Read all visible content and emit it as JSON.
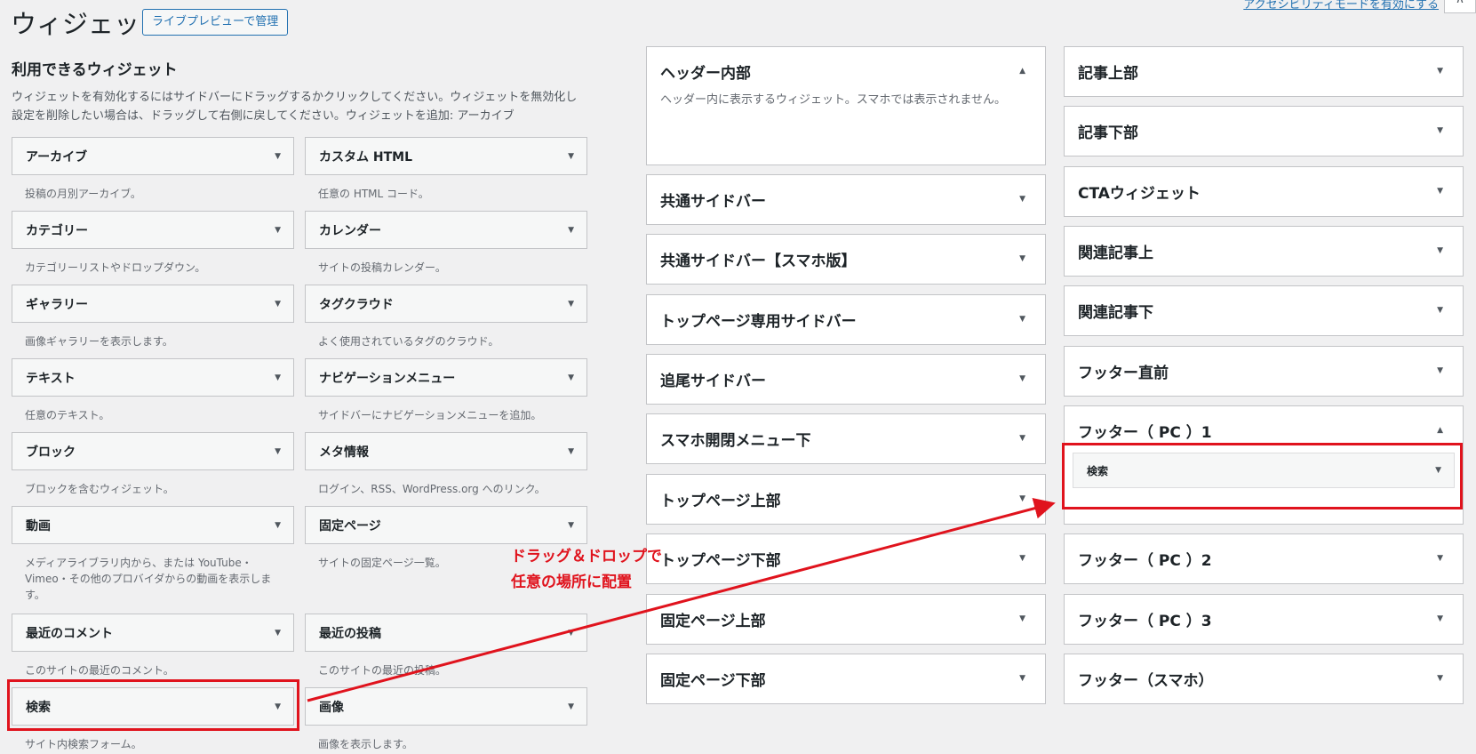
{
  "header": {
    "title": "ウィジェット",
    "preview_button": "ライブプレビューで管理",
    "accessibility_link": "アクセシビリティモードを有効にする",
    "corner_toggle": "∧"
  },
  "available": {
    "title": "利用できるウィジェット",
    "description_line1": "ウィジェットを有効化するにはサイドバーにドラッグするかクリックしてください。ウィジェットを無効化し",
    "description_line2": "設定を削除したい場合は、ドラッグして右側に戻してください。ウィジェットを追加: アーカイブ",
    "widgets": [
      {
        "name": "アーカイブ",
        "desc": "投稿の月別アーカイブ。"
      },
      {
        "name": "カスタム HTML",
        "desc": "任意の HTML コード。"
      },
      {
        "name": "カテゴリー",
        "desc": "カテゴリーリストやドロップダウン。"
      },
      {
        "name": "カレンダー",
        "desc": "サイトの投稿カレンダー。"
      },
      {
        "name": "ギャラリー",
        "desc": "画像ギャラリーを表示します。"
      },
      {
        "name": "タグクラウド",
        "desc": "よく使用されているタグのクラウド。"
      },
      {
        "name": "テキスト",
        "desc": "任意のテキスト。"
      },
      {
        "name": "ナビゲーションメニュー",
        "desc": "サイドバーにナビゲーションメニューを追加。"
      },
      {
        "name": "ブロック",
        "desc": "ブロックを含むウィジェット。"
      },
      {
        "name": "メタ情報",
        "desc": "ログイン、RSS、WordPress.org へのリンク。"
      },
      {
        "name": "動画",
        "desc": "メディアライブラリ内から、または YouTube・Vimeo・その他のプロバイダからの動画を表示します。"
      },
      {
        "name": "固定ページ",
        "desc": "サイトの固定ページ一覧。"
      },
      {
        "name": "最近のコメント",
        "desc": "このサイトの最近のコメント。"
      },
      {
        "name": "最近の投稿",
        "desc": "このサイトの最近の投稿。"
      },
      {
        "name": "検索",
        "desc": "サイト内検索フォーム。"
      },
      {
        "name": "画像",
        "desc": "画像を表示します。"
      }
    ]
  },
  "sidebars_col1": [
    {
      "name": "ヘッダー内部",
      "desc": "ヘッダー内に表示するウィジェット。スマホでは表示されません。",
      "arrow": "▲"
    },
    {
      "name": "共通サイドバー",
      "arrow": "▼"
    },
    {
      "name": "共通サイドバー【スマホ版】",
      "arrow": "▼"
    },
    {
      "name": "トップページ専用サイドバー",
      "arrow": "▼"
    },
    {
      "name": "追尾サイドバー",
      "arrow": "▼"
    },
    {
      "name": "スマホ開閉メニュー下",
      "arrow": "▼"
    },
    {
      "name": "トップページ上部",
      "arrow": "▼"
    },
    {
      "name": "トップページ下部",
      "arrow": "▼"
    },
    {
      "name": "固定ページ上部",
      "arrow": "▼"
    },
    {
      "name": "固定ページ下部",
      "arrow": "▼"
    }
  ],
  "sidebars_col2": [
    {
      "name": "記事上部",
      "arrow": "▼"
    },
    {
      "name": "記事下部",
      "arrow": "▼"
    },
    {
      "name": "CTAウィジェット",
      "arrow": "▼"
    },
    {
      "name": "関連記事上",
      "arrow": "▼"
    },
    {
      "name": "関連記事下",
      "arrow": "▼"
    },
    {
      "name": "フッター直前",
      "arrow": "▼"
    },
    {
      "name": "フッター（ PC ）1",
      "arrow": "▲",
      "placed_widget": "検索"
    },
    {
      "name": "フッター（ PC ）2",
      "arrow": "▼"
    },
    {
      "name": "フッター（ PC ）3",
      "arrow": "▼"
    },
    {
      "name": "フッター（スマホ）",
      "arrow": "▼"
    }
  ],
  "annotation": {
    "line1": "ドラッグ＆ドロップで",
    "line2": "任意の場所に配置",
    "color": "#e0131d"
  },
  "icons": {
    "collapse": "▼",
    "expand": "▲"
  }
}
